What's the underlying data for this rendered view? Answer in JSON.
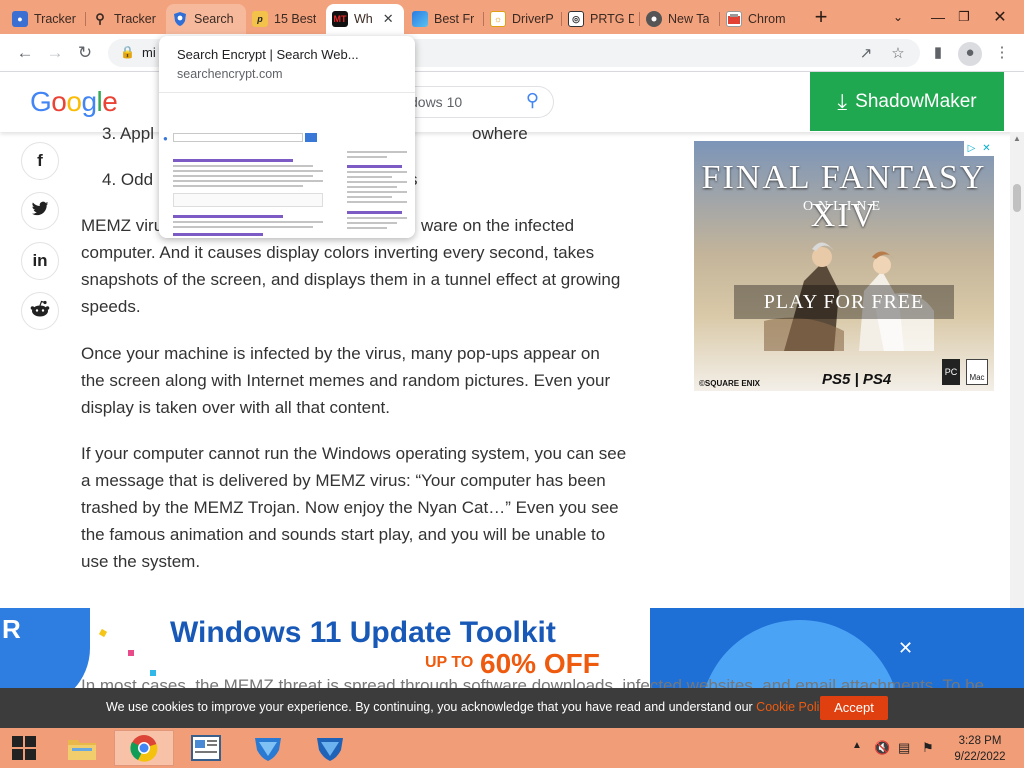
{
  "colors": {
    "tabstrip": "#f3a27e",
    "taskbar": "#f19d78",
    "shadowmaker": "#1fa84f",
    "accept": "#e0400f",
    "cookie_link": "#ee5a0e"
  },
  "tabs": [
    {
      "title": "Tracker",
      "icon": "tracker-favicon"
    },
    {
      "title": "Tracker",
      "icon": "search-favicon"
    },
    {
      "title": "Search",
      "icon": "search-encrypt-shield-favicon"
    },
    {
      "title": "15 Best",
      "icon": "p-favicon"
    },
    {
      "title": "Wh",
      "icon": "mt-favicon"
    },
    {
      "title": "Best Fr",
      "icon": "best-free-favicon"
    },
    {
      "title": "DriverP",
      "icon": "driverpack-favicon"
    },
    {
      "title": "PRTG D",
      "icon": "prtg-favicon"
    },
    {
      "title": "New Ta",
      "icon": "chrome-favicon"
    },
    {
      "title": "Chrom",
      "icon": "chrome-store-favicon"
    }
  ],
  "mt_badge": "MT",
  "toolbar": {
    "url": "mi",
    "new_tab": "+"
  },
  "hovercard": {
    "title": "Search Encrypt | Search Web...",
    "domain": "searchencrypt.com"
  },
  "header": {
    "logo": "Google",
    "search_query": "dows 10",
    "shadowmaker_label": "ShadowMaker"
  },
  "social": [
    "f",
    "t",
    "in",
    "r"
  ],
  "article": {
    "list_item_3": "3. Appl",
    "list_item_3_tail": "owhere",
    "list_item_4": "4. Odd",
    "list_item_4_tail": "s",
    "para1_start": "MEMZ viru",
    "para1_head_tail": "ware on the infected",
    "para1_rest": "computer. And it causes display colors inverting every second, takes snapshots of the screen, and displays them in a tunnel effect at growing speeds.",
    "para2": "Once your machine is infected by the virus, many pop-ups appear on the screen along with Internet memes and random pictures. Even your display is taken over with all that content.",
    "para3": "If your computer cannot run the Windows operating system, you can see a message that is delivered by MEMZ virus: “Your computer has been trashed by the MEMZ Trojan. Now enjoy the Nyan Cat…” Even you see the famous animation and sounds start play, and you will be unable to use the system.",
    "para4_partial": "In most cases, the MEMZ threat is spread through software downloads, infected websites, and email attachments. To be"
  },
  "ad": {
    "title": "FINAL FANTASY XIV",
    "subtitle": "ONLINE",
    "cta": "PLAY FOR FREE",
    "copyright": "©SQUARE ENIX",
    "platforms": "PS5 | PS4",
    "pc_badge": "PC",
    "mac_badge": "Mac"
  },
  "banner": {
    "title": "Windows 11 Update Toolkit",
    "upto": "UP TO",
    "percent": "60% OFF",
    "left_letter": "R"
  },
  "cookie": {
    "text": "We use cookies to improve your experience. By continuing, you acknowledge that you have read and understand our ",
    "link": "Cookie Policy",
    "end": ".",
    "accept": "Accept"
  },
  "clock": {
    "time": "3:28 PM",
    "date": "9/22/2022"
  }
}
